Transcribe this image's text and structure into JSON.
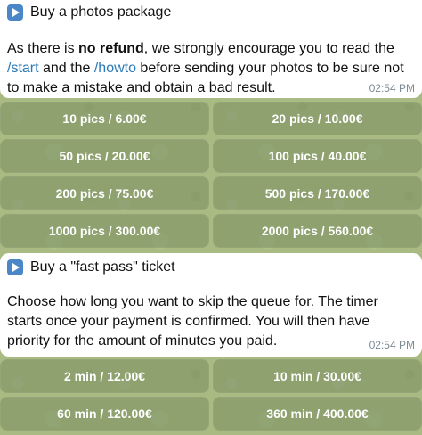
{
  "message1": {
    "title": "Buy a photos package",
    "body_prefix": "As there is ",
    "body_bold": "no refund",
    "body_mid1": ", we strongly encourage you to read the ",
    "cmd_start": "/start",
    "body_mid2": " and the ",
    "cmd_howto": "/howto",
    "body_suffix": " before sending your photos to be sure not to make a mistake and obtain a bad result.",
    "time": "02:54 PM"
  },
  "keyboard1": {
    "rows": [
      [
        "10 pics / 6.00€",
        "20 pics / 10.00€"
      ],
      [
        "50 pics / 20.00€",
        "100 pics / 40.00€"
      ],
      [
        "200 pics / 75.00€",
        "500 pics / 170.00€"
      ],
      [
        "1000 pics / 300.00€",
        "2000 pics / 560.00€"
      ]
    ]
  },
  "message2": {
    "title": "Buy a \"fast pass\" ticket",
    "body": "Choose how long you want to skip the queue for. The timer starts once your payment is confirmed. You will then have priority for the amount of minutes you paid.",
    "time": "02:54 PM"
  },
  "keyboard2": {
    "rows": [
      [
        "2 min / 12.00€",
        "10 min / 30.00€"
      ],
      [
        "60 min / 120.00€",
        "360 min / 400.00€"
      ]
    ]
  },
  "colors": {
    "bubble": "#ffffff",
    "link": "#2a7ab8",
    "time": "#7c8a94",
    "chat_background": "#a9bb83"
  },
  "icons": {
    "title_icon": "play-button-icon"
  }
}
